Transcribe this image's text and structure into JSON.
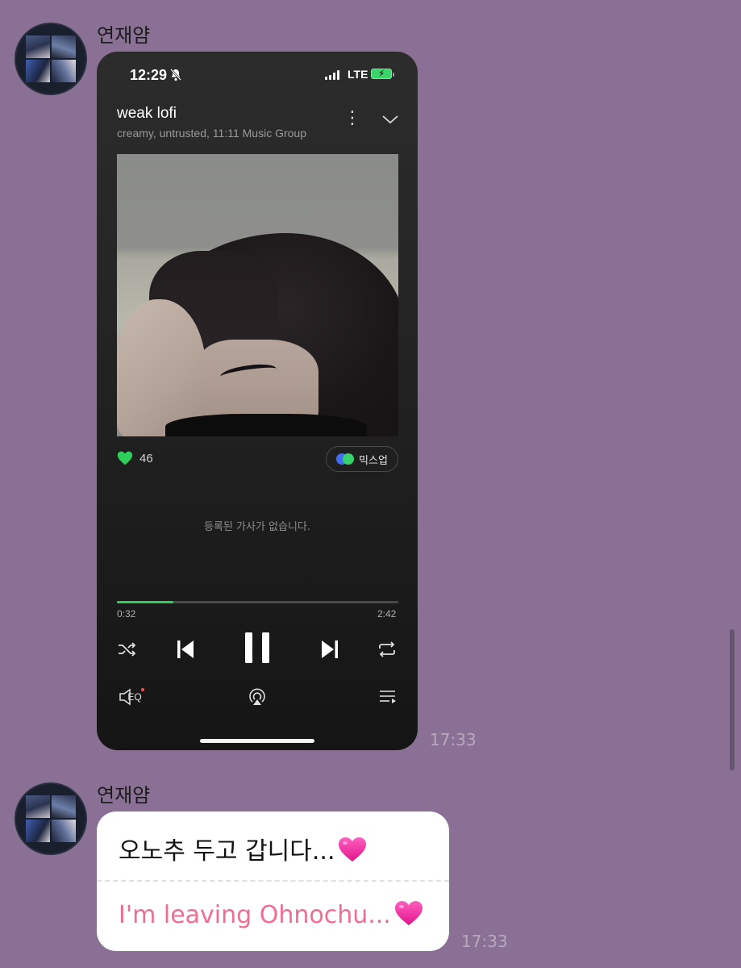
{
  "messages": [
    {
      "sender": "연재얌",
      "time": "17:33",
      "type": "image",
      "screenshot": {
        "status_bar": {
          "clock": "12:29",
          "network": "LTE"
        },
        "track": {
          "title": "weak lofi",
          "subtitle": "creamy, untrusted, 11:11 Music Group"
        },
        "likes": "46",
        "mixup_label": "믹스업",
        "lyrics_message": "등록된 가사가 없습니다.",
        "progress": {
          "current": "0:32",
          "total": "2:42",
          "fraction": 0.2
        },
        "eq_label": "EQ",
        "colors": {
          "accent": "#2fcf59",
          "background": "#1c1c1c"
        },
        "icons": [
          "mute-bell-icon",
          "more-icon",
          "chevron-down-icon",
          "heart-icon",
          "shuffle-icon",
          "previous-icon",
          "pause-icon",
          "next-icon",
          "repeat-icon",
          "eq-icon",
          "airplay-icon",
          "playlist-icon"
        ]
      }
    },
    {
      "sender": "연재얌",
      "time": "17:33",
      "type": "text",
      "original": "오노추 두고 갑니다...",
      "translation": "I'm leaving Ohnochu...",
      "emoji": "pink-heart"
    }
  ],
  "colors": {
    "chat_background": "#8b7095",
    "translation_text": "#ef6e92"
  }
}
